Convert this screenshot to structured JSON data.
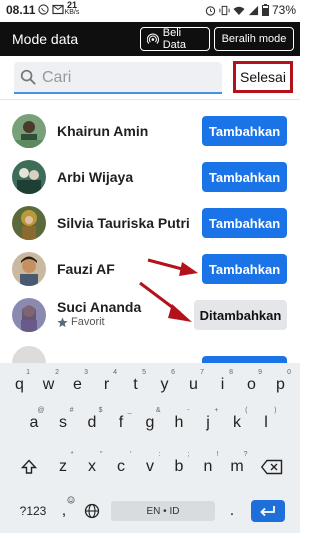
{
  "status_bar": {
    "time": "08.11",
    "speed_value": "21",
    "speed_unit": "KB/s",
    "battery": "73%",
    "icons": [
      "whatsapp-icon",
      "mail-icon",
      "alarm-icon",
      "vibrate-icon",
      "wifi-icon",
      "signal-icon",
      "battery-icon"
    ]
  },
  "header": {
    "title": "Mode data",
    "beli_data_label": "Beli Data",
    "beralih_mode_label": "Beralih mode"
  },
  "search": {
    "placeholder": "Cari",
    "value": "",
    "done_label": "Selesai"
  },
  "contacts": [
    {
      "name": "Khairun Amin",
      "subtitle": "",
      "action": "Tambahkan",
      "state": "add"
    },
    {
      "name": "Arbi Wijaya",
      "subtitle": "",
      "action": "Tambahkan",
      "state": "add"
    },
    {
      "name": "Silvia Tauriska Putri",
      "subtitle": "",
      "action": "Tambahkan",
      "state": "add"
    },
    {
      "name": "Fauzi AF",
      "subtitle": "",
      "action": "Tambahkan",
      "state": "add"
    },
    {
      "name": "Suci Ananda",
      "subtitle": "Favorit",
      "action": "Ditambahkan",
      "state": "added"
    }
  ],
  "colors": {
    "accent_blue": "#1b73e8",
    "highlight_red": "#b3121b",
    "header_bg": "#0f0f0f"
  },
  "keyboard": {
    "row1": [
      "q",
      "w",
      "e",
      "r",
      "t",
      "y",
      "u",
      "i",
      "o",
      "p"
    ],
    "row1_hints": [
      "1",
      "2",
      "3",
      "4",
      "5",
      "6",
      "7",
      "8",
      "9",
      "0"
    ],
    "row2": [
      "a",
      "s",
      "d",
      "f",
      "g",
      "h",
      "j",
      "k",
      "l"
    ],
    "row2_hints": [
      "@",
      "#",
      "$",
      "_",
      "&",
      "-",
      "+",
      "(",
      ")"
    ],
    "row3": [
      "z",
      "x",
      "c",
      "v",
      "b",
      "n",
      "m"
    ],
    "row3_hints": [
      "*",
      "\"",
      "'",
      ":",
      ";",
      "!",
      "?"
    ],
    "symbols_label": "?123",
    "comma": ",",
    "period": ".",
    "space_label": "EN • ID"
  }
}
